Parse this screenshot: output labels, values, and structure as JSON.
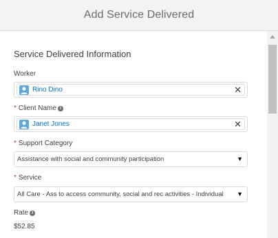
{
  "modal": {
    "title": "Add Service Delivered"
  },
  "section": {
    "title": "Service Delivered Information"
  },
  "fields": {
    "worker": {
      "label": "Worker",
      "value": "Rino Dino"
    },
    "client_name": {
      "required_mark": "*",
      "label": "Client Name",
      "value": "Janet Jones"
    },
    "support_category": {
      "required_mark": "*",
      "label": "Support Category",
      "value": "Assistance with social and community participation"
    },
    "service": {
      "required_mark": "*",
      "label": "Service",
      "value": "All Care - Ass to access community, social and rec activities - Individual"
    },
    "rate": {
      "label": "Rate",
      "value": "$52.85"
    }
  },
  "icons": {
    "info": "info-icon",
    "avatar": "contact-avatar-icon",
    "clear": "close-icon",
    "caret": "caret-down-icon"
  },
  "colors": {
    "header_bg": "#f3f3f3",
    "link_blue": "#0070d2",
    "required_red": "#c23934",
    "avatar_blue": "#5fa8dc"
  }
}
